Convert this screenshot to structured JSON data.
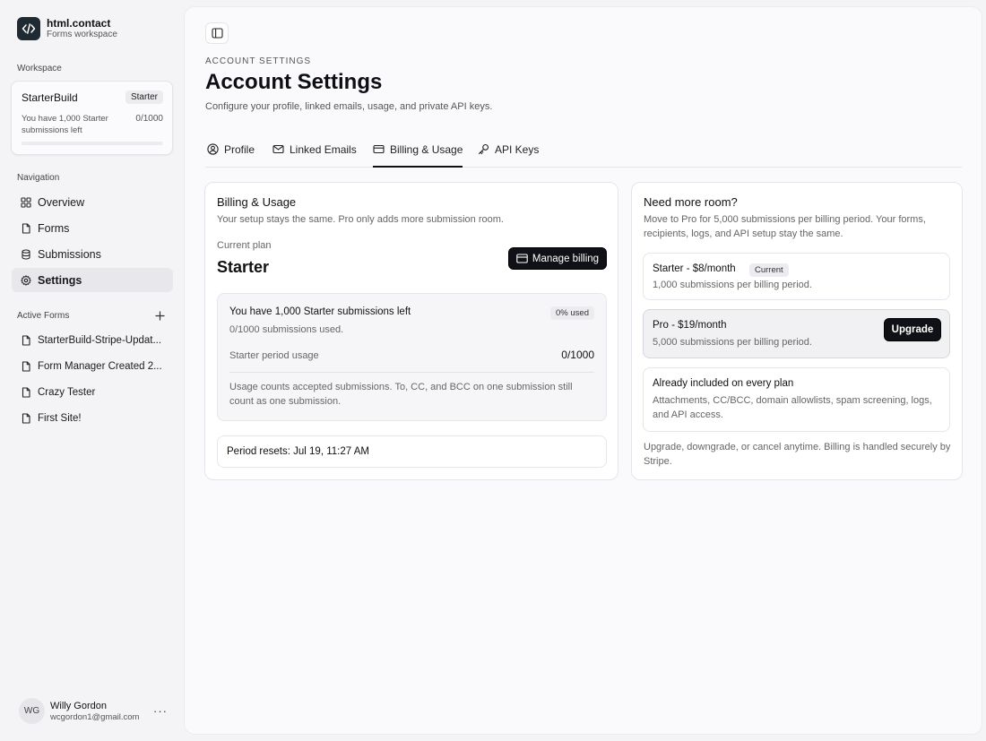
{
  "brand": {
    "name": "html.contact",
    "subtitle": "Forms workspace"
  },
  "workspace": {
    "section_label": "Workspace",
    "name": "StarterBuild",
    "plan_badge": "Starter",
    "remaining_text": "You have 1,000 Starter submissions left",
    "count": "0/1000",
    "usage_fraction": 0
  },
  "navigation": {
    "label": "Navigation",
    "items": [
      {
        "label": "Overview",
        "icon": "grid-icon"
      },
      {
        "label": "Forms",
        "icon": "file-icon"
      },
      {
        "label": "Submissions",
        "icon": "database-icon"
      },
      {
        "label": "Settings",
        "icon": "gear-icon",
        "active": true
      }
    ]
  },
  "active_forms": {
    "label": "Active Forms",
    "items": [
      "StarterBuild-Stripe-Updat...",
      "Form Manager Created 2...",
      "Crazy Tester",
      "First Site!"
    ]
  },
  "user": {
    "initials": "WG",
    "name": "Willy Gordon",
    "email": "wcgordon1@gmail.com",
    "more": "···"
  },
  "header": {
    "eyebrow": "ACCOUNT SETTINGS",
    "title": "Account Settings",
    "subtitle": "Configure your profile, linked emails, usage, and private API keys."
  },
  "tabs": [
    {
      "label": "Profile",
      "icon": "user-circle-icon"
    },
    {
      "label": "Linked Emails",
      "icon": "mail-icon"
    },
    {
      "label": "Billing & Usage",
      "icon": "credit-card-icon",
      "active": true
    },
    {
      "label": "API Keys",
      "icon": "key-icon"
    }
  ],
  "billing": {
    "title": "Billing & Usage",
    "subtitle": "Your setup stays the same. Pro only adds more submission room.",
    "current_plan_label": "Current plan",
    "current_plan": "Starter",
    "manage_button": "Manage billing",
    "usage_title": "You have 1,000 Starter submissions left",
    "usage_pill": "0% used",
    "usage_sub": "0/1000 submissions used.",
    "period_label": "Starter period usage",
    "period_value": "0/1000",
    "note": "Usage counts accepted submissions. To, CC, and BCC on one submission still count as one submission.",
    "reset_text": "Period resets: Jul 19, 11:27 AM"
  },
  "upgrade": {
    "title": "Need more room?",
    "subtitle": "Move to Pro for 5,000 submissions per billing period. Your forms, recipients, logs, and API setup stay the same.",
    "starter": {
      "name": "Starter - $8/month",
      "badge": "Current",
      "desc": "1,000 submissions per billing period."
    },
    "pro": {
      "name": "Pro - $19/month",
      "desc": "5,000 submissions per billing period.",
      "button": "Upgrade"
    },
    "included": {
      "title": "Already included on every plan",
      "desc": "Attachments, CC/BCC, domain allowlists, spam screening, logs, and API access."
    },
    "footer": "Upgrade, downgrade, or cancel anytime. Billing is handled securely by Stripe."
  }
}
